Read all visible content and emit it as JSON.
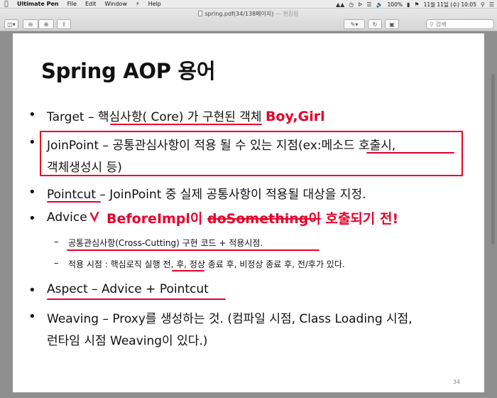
{
  "menubar": {
    "app_name": "Ultimate Pen",
    "items": [
      "File",
      "Edit",
      "Window",
      "Help"
    ],
    "battery": "100%",
    "datetime": "11월 11일 (수)  10:05"
  },
  "window": {
    "file_name": "spring.pdf(34/138페이지)",
    "edited_suffix": "— 편집됨",
    "search_placeholder": "검색"
  },
  "slide": {
    "title": "Spring AOP 용어",
    "page_number": "34",
    "bullets": {
      "target_a": "Target – ",
      "target_b": "핵심사항( Core) 가 구현된 객체",
      "target_note": "Boy,Girl",
      "joinpoint_a": "JoinPoint – 공통관심사항이 적용 될 수 있는 지점(ex:",
      "joinpoint_b": "메소드 호출시",
      "joinpoint_c": ",",
      "joinpoint_2": "객체생성시 등)",
      "pointcut_a": "Pointcut",
      "pointcut_b": " – JoinPoint 중 실제 공통사항이 적용될 대상을 지정.",
      "advice": "Advice",
      "advice_note_a": "BeforeImpl이 ",
      "advice_note_b": "doSomething이",
      "advice_note_c": " 호출되기 전!",
      "sub1": "공통관심사항(Cross-Cutting) 구현 코드 + 적용시점.",
      "sub2_a": "적용 시점 : 핵심로직 ",
      "sub2_b": "실행 전",
      "sub2_c": ", 후, 정상 종료 후, 비정상 종료 후, 전/후가 있다.",
      "aspect": "Aspect – Advice + Pointcut",
      "weaving_1": "Weaving – Proxy를 생성하는 것. (컴파일 시점, Class Loading 시점,",
      "weaving_2": "런타임 시점 Weaving이 있다.)"
    },
    "bullet_mark": "•",
    "dash_mark": "–"
  },
  "colors": {
    "annotation": "#e8002a",
    "page_bg": "#8f8f8f"
  }
}
